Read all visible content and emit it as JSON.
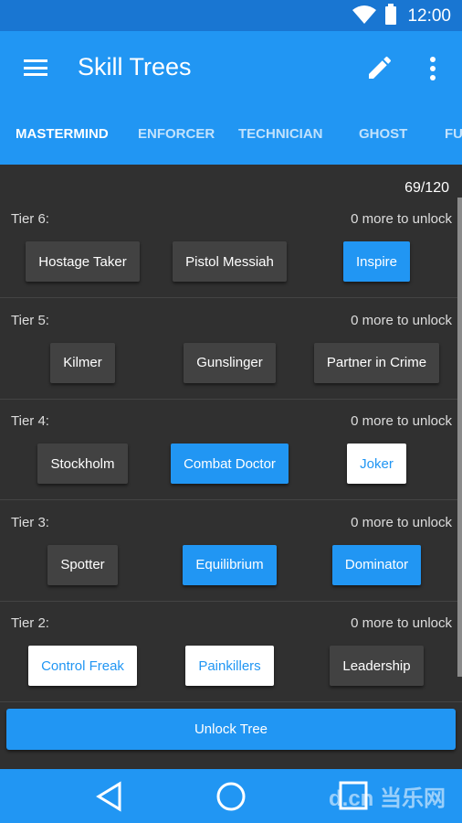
{
  "status": {
    "time": "12:00"
  },
  "appbar": {
    "title": "Skill Trees"
  },
  "tabs": [
    {
      "label": "MASTERMIND",
      "active": true
    },
    {
      "label": "ENFORCER"
    },
    {
      "label": "TECHNICIAN"
    },
    {
      "label": "GHOST"
    },
    {
      "label": "FU"
    }
  ],
  "points": "69/120",
  "tiers": [
    {
      "label": "Tier 6:",
      "unlock": "0 more to unlock",
      "skills": [
        {
          "name": "Hostage Taker",
          "state": "locked"
        },
        {
          "name": "Pistol Messiah",
          "state": "locked"
        },
        {
          "name": "Inspire",
          "state": "active"
        }
      ]
    },
    {
      "label": "Tier 5:",
      "unlock": "0 more to unlock",
      "skills": [
        {
          "name": "Kilmer",
          "state": "locked"
        },
        {
          "name": "Gunslinger",
          "state": "locked"
        },
        {
          "name": "Partner in Crime",
          "state": "locked"
        }
      ]
    },
    {
      "label": "Tier 4:",
      "unlock": "0 more to unlock",
      "skills": [
        {
          "name": "Stockholm",
          "state": "locked"
        },
        {
          "name": "Combat Doctor",
          "state": "active"
        },
        {
          "name": "Joker",
          "state": "available"
        }
      ]
    },
    {
      "label": "Tier 3:",
      "unlock": "0 more to unlock",
      "skills": [
        {
          "name": "Spotter",
          "state": "locked"
        },
        {
          "name": "Equilibrium",
          "state": "active"
        },
        {
          "name": "Dominator",
          "state": "active"
        }
      ]
    },
    {
      "label": "Tier 2:",
      "unlock": "0 more to unlock",
      "skills": [
        {
          "name": "Control Freak",
          "state": "available"
        },
        {
          "name": "Painkillers",
          "state": "available"
        },
        {
          "name": "Leadership",
          "state": "locked"
        }
      ]
    }
  ],
  "unlock_button": "Unlock Tree",
  "watermark": "d.cn 当乐网",
  "colors": {
    "primary": "#2196F3",
    "primary_dark": "#1976D2",
    "accent": "#F5A623",
    "background": "#303030"
  }
}
